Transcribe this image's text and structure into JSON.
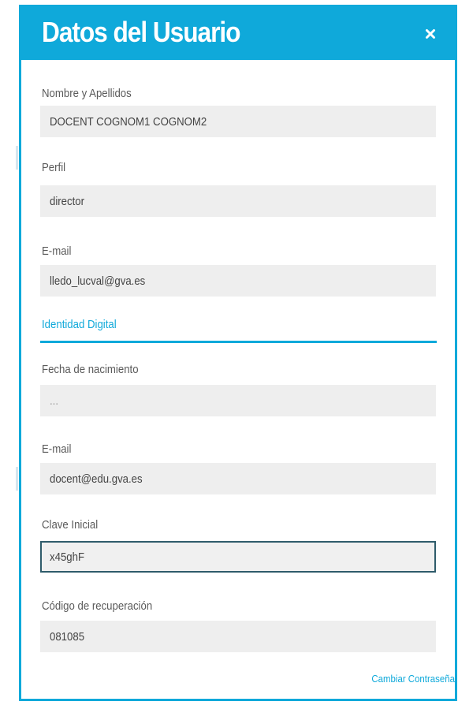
{
  "dialog": {
    "title": "Datos del Usuario",
    "close_icon": "close-icon"
  },
  "fields": {
    "name": {
      "label": "Nombre y Apellidos",
      "value": "DOCENT COGNOM1 COGNOM2"
    },
    "profile": {
      "label": "Perfil",
      "value": "director"
    },
    "email": {
      "label": "E-mail",
      "value": "lledo_lucval@gva.es"
    }
  },
  "digital_identity": {
    "section_title": "Identidad Digital",
    "birth_date": {
      "label": "Fecha de nacimiento",
      "value": "..."
    },
    "email": {
      "label": "E-mail",
      "value": "docent@edu.gva.es"
    },
    "initial_key": {
      "label": "Clave Inicial",
      "value": "x45ghF"
    },
    "recovery_code": {
      "label": "Código de recuperación",
      "value": "081085"
    }
  },
  "actions": {
    "change_password_label": "Cambiar Contraseña"
  },
  "colors": {
    "accent": "#0fa9da",
    "field_bg": "#eeeeee",
    "active_border": "#2f5c6b"
  }
}
